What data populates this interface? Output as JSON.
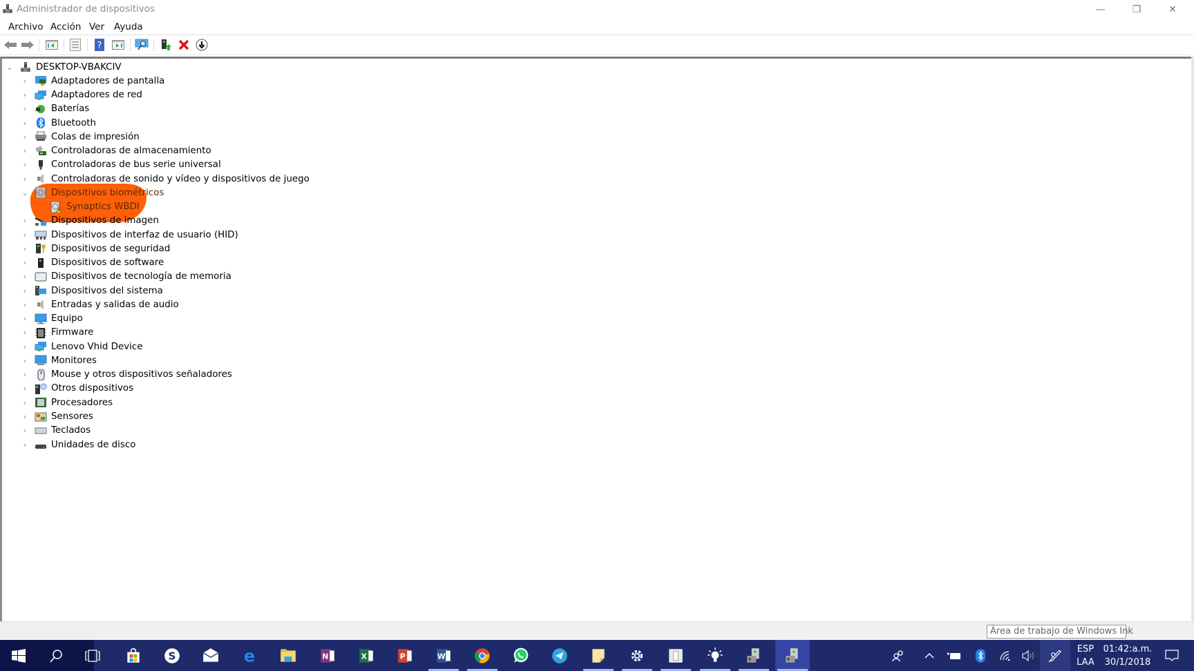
{
  "window": {
    "title": "Administrador de dispositivos",
    "controls": {
      "minimize": "—",
      "restore": "❐",
      "close": "✕"
    }
  },
  "menu": [
    "Archivo",
    "Acción",
    "Ver",
    "Ayuda"
  ],
  "toolbar": [
    {
      "name": "back-icon"
    },
    {
      "name": "forward-icon"
    },
    {
      "name": "show-hide-console-tree-icon"
    },
    {
      "name": "properties-icon"
    },
    {
      "name": "help-icon"
    },
    {
      "name": "show-action-pane-icon"
    },
    {
      "name": "scan-hardware-changes-icon"
    },
    {
      "name": "update-driver-icon"
    },
    {
      "name": "uninstall-device-icon"
    },
    {
      "name": "disable-device-icon"
    }
  ],
  "tree": {
    "root": {
      "label": "DESKTOP-VBAKCIV",
      "expanded": true
    },
    "categories": [
      {
        "label": "Adaptadores de pantalla",
        "icon": "display-adapter-icon"
      },
      {
        "label": "Adaptadores de red",
        "icon": "network-adapter-icon"
      },
      {
        "label": "Baterías",
        "icon": "battery-icon"
      },
      {
        "label": "Bluetooth",
        "icon": "bluetooth-icon"
      },
      {
        "label": "Colas de impresión",
        "icon": "printer-icon"
      },
      {
        "label": "Controladoras de almacenamiento",
        "icon": "storage-controller-icon"
      },
      {
        "label": "Controladoras de bus serie universal",
        "icon": "usb-icon"
      },
      {
        "label": "Controladoras de sonido y vídeo y dispositivos de juego",
        "icon": "speaker-icon"
      },
      {
        "label": "Dispositivos biométricos",
        "icon": "fingerprint-icon",
        "expanded": true,
        "highlighted": true,
        "children": [
          {
            "label": "Synaptics WBDI",
            "icon": "fingerprint-warning-icon",
            "warning": true
          }
        ]
      },
      {
        "label": "Dispositivos de imagen",
        "icon": "camera-icon"
      },
      {
        "label": "Dispositivos de interfaz de usuario (HID)",
        "icon": "hid-icon"
      },
      {
        "label": "Dispositivos de seguridad",
        "icon": "security-device-icon"
      },
      {
        "label": "Dispositivos de software",
        "icon": "software-device-icon"
      },
      {
        "label": "Dispositivos de tecnología de memoria",
        "icon": "memory-device-icon"
      },
      {
        "label": "Dispositivos del sistema",
        "icon": "system-device-icon"
      },
      {
        "label": "Entradas y salidas de audio",
        "icon": "audio-io-icon"
      },
      {
        "label": "Equipo",
        "icon": "computer-icon"
      },
      {
        "label": "Firmware",
        "icon": "firmware-icon"
      },
      {
        "label": "Lenovo Vhid Device",
        "icon": "lenovo-vhid-icon"
      },
      {
        "label": "Monitores",
        "icon": "monitor-icon"
      },
      {
        "label": "Mouse y otros dispositivos señaladores",
        "icon": "mouse-icon"
      },
      {
        "label": "Otros dispositivos",
        "icon": "other-devices-icon"
      },
      {
        "label": "Procesadores",
        "icon": "processor-icon"
      },
      {
        "label": "Sensores",
        "icon": "sensor-icon"
      },
      {
        "label": "Teclados",
        "icon": "keyboard-icon"
      },
      {
        "label": "Unidades de disco",
        "icon": "disk-drive-icon"
      }
    ]
  },
  "tooltip": "Área de trabajo de Windows Ink",
  "taskbar": {
    "apps": [
      {
        "name": "microsoft-store",
        "running": false
      },
      {
        "name": "skype",
        "running": false
      },
      {
        "name": "mail",
        "running": false
      },
      {
        "name": "edge",
        "running": false
      },
      {
        "name": "file-explorer",
        "running": false
      },
      {
        "name": "onenote",
        "running": false
      },
      {
        "name": "excel",
        "running": false
      },
      {
        "name": "powerpoint",
        "running": false
      },
      {
        "name": "word",
        "running": true
      },
      {
        "name": "chrome",
        "running": true
      },
      {
        "name": "whatsapp",
        "running": false
      },
      {
        "name": "telegram",
        "running": false
      },
      {
        "name": "sticky-notes",
        "running": true
      },
      {
        "name": "settings",
        "running": true
      },
      {
        "name": "document-app",
        "running": true
      },
      {
        "name": "tips",
        "running": true
      },
      {
        "name": "device-manager-a",
        "running": true
      },
      {
        "name": "device-manager-b",
        "running": true,
        "active": true
      }
    ],
    "language": {
      "line1": "ESP",
      "line2": "LAA"
    },
    "time": "01:42:a.m.",
    "date": "30/1/2018"
  },
  "colors": {
    "highlight": "#ff5a00",
    "taskbar": "#1f2a6b",
    "taskbar_start": "#0d1548",
    "taskbar_active": "#3445a4"
  }
}
